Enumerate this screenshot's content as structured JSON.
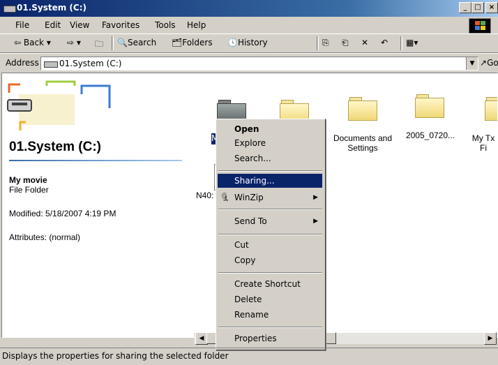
{
  "window": {
    "title": "01.System (C:)"
  },
  "menu": [
    "File",
    "Edit",
    "View",
    "Favorites",
    "Tools",
    "Help"
  ],
  "toolbar": {
    "back": "Back",
    "search": "Search",
    "folders": "Folders",
    "history": "History"
  },
  "address": {
    "label": "Address",
    "value": "01.System (C:)",
    "go": "Go"
  },
  "leftpane": {
    "title": "01.System (C:)",
    "item_name": "My movie",
    "item_type": "File Folder",
    "modified": "Modified: 5/18/2007 4:19 PM",
    "attributes": "Attributes: (normal)"
  },
  "folders": [
    {
      "label": "M"
    },
    {
      "label": ""
    },
    {
      "label": "Documents and Settings"
    },
    {
      "label": "2005_0720..."
    },
    {
      "label": "My Tx Fi"
    }
  ],
  "partial_label": "N40:",
  "context_menu": [
    {
      "label": "Open"
    },
    {
      "label": "Explore"
    },
    {
      "label": "Search..."
    },
    {
      "label": "Sharing..."
    },
    {
      "label": "WinZip"
    },
    {
      "label": "Send To"
    },
    {
      "label": "Cut"
    },
    {
      "label": "Copy"
    },
    {
      "label": "Create Shortcut"
    },
    {
      "label": "Delete"
    },
    {
      "label": "Rename"
    },
    {
      "label": "Properties"
    }
  ],
  "status": "Displays the properties for sharing the selected folder",
  "colors": {
    "titlebar": "#0a246a",
    "selection": "#0a246a",
    "chrome": "#d4d0c8"
  }
}
